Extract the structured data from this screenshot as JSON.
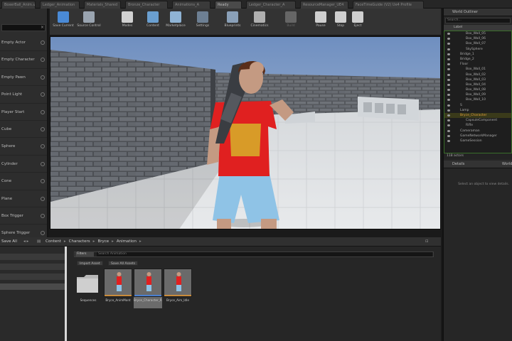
{
  "tabs": [
    "BoxerBall_Anim.uasset",
    "Ledger_Animation",
    "Materials_Shared",
    "Bronze_Character",
    "Animations_A",
    "Ready",
    "Ledger_Character_A",
    "ResourceManager_UE4",
    "FaceTimeGuide (V2) Ue4 Profile"
  ],
  "modes": {
    "search_value": "",
    "items": [
      "Empty Actor",
      "Empty Character",
      "Empty Pawn",
      "Point Light",
      "Player Start",
      "Cube",
      "Sphere",
      "Cylinder",
      "Cone",
      "Plane",
      "Box Trigger",
      "Sphere Trigger"
    ]
  },
  "toolbar": {
    "buttons": [
      {
        "label": "Save Current",
        "icon": "save-icon"
      },
      {
        "label": "Source Control",
        "icon": "source-control-icon"
      },
      {
        "label": "Modes",
        "icon": "modes-icon"
      },
      {
        "label": "Content",
        "icon": "content-icon"
      },
      {
        "label": "Marketplace",
        "icon": "marketplace-icon"
      },
      {
        "label": "Settings",
        "icon": "settings-icon"
      },
      {
        "label": "Blueprints",
        "icon": "blueprints-icon"
      },
      {
        "label": "Cinematics",
        "icon": "cinematics-icon"
      },
      {
        "label": "Build",
        "icon": "build-icon"
      },
      {
        "label": "Pause",
        "icon": "pause-icon"
      },
      {
        "label": "Stop",
        "icon": "stop-icon"
      },
      {
        "label": "Eject",
        "icon": "eject-icon"
      }
    ]
  },
  "content_browser": {
    "save_all": "Save All",
    "breadcrumb": [
      "Content",
      "Characters",
      "Bryce",
      "Animation"
    ],
    "filters": "Filters",
    "search_placeholder": "Search Animation",
    "import_label": "Import Asset",
    "save_label": "Save All Assets",
    "assets": [
      {
        "name": "Sequences",
        "type": "folder"
      },
      {
        "name": "Bryce_AnimMont",
        "type": "anim"
      },
      {
        "name": "Bryce_Character_Rifle_Idle",
        "type": "anim"
      },
      {
        "name": "Bryce_Aim_Idle",
        "type": "anim"
      }
    ]
  },
  "world_outliner": {
    "title": "World Outliner",
    "search_placeholder": "Search...",
    "column_label": "Label",
    "items": [
      {
        "name": "Box_Wall_05",
        "indent": 2
      },
      {
        "name": "Box_Wall_06",
        "indent": 2
      },
      {
        "name": "Box_Wall_07",
        "indent": 2
      },
      {
        "name": "SkySphere",
        "indent": 2
      },
      {
        "name": "Bridge_1",
        "indent": 1
      },
      {
        "name": "Bridge_2",
        "indent": 1
      },
      {
        "name": "Floor",
        "indent": 1
      },
      {
        "name": "Box_Wall_01",
        "indent": 2
      },
      {
        "name": "Box_Wall_02",
        "indent": 2
      },
      {
        "name": "Box_Wall_03",
        "indent": 2
      },
      {
        "name": "Box_Wall_04",
        "indent": 2
      },
      {
        "name": "Box_Wall_08",
        "indent": 2
      },
      {
        "name": "Box_Wall_09",
        "indent": 2
      },
      {
        "name": "Box_Wall_10",
        "indent": 2
      },
      {
        "name": "S",
        "indent": 1
      },
      {
        "name": "Lamp",
        "indent": 1
      },
      {
        "name": "Bryce_Character",
        "indent": 1,
        "selected": true
      },
      {
        "name": "CapsuleComponent",
        "indent": 2
      },
      {
        "name": "Rifle",
        "indent": 2
      },
      {
        "name": "Cameraman",
        "indent": 1
      },
      {
        "name": "GameNetworkManager",
        "indent": 1
      },
      {
        "name": "GameSession",
        "indent": 1
      }
    ],
    "count": "118 actors"
  },
  "details": {
    "tab1": "Details",
    "tab2": "World",
    "message": "Select an object to view details."
  }
}
